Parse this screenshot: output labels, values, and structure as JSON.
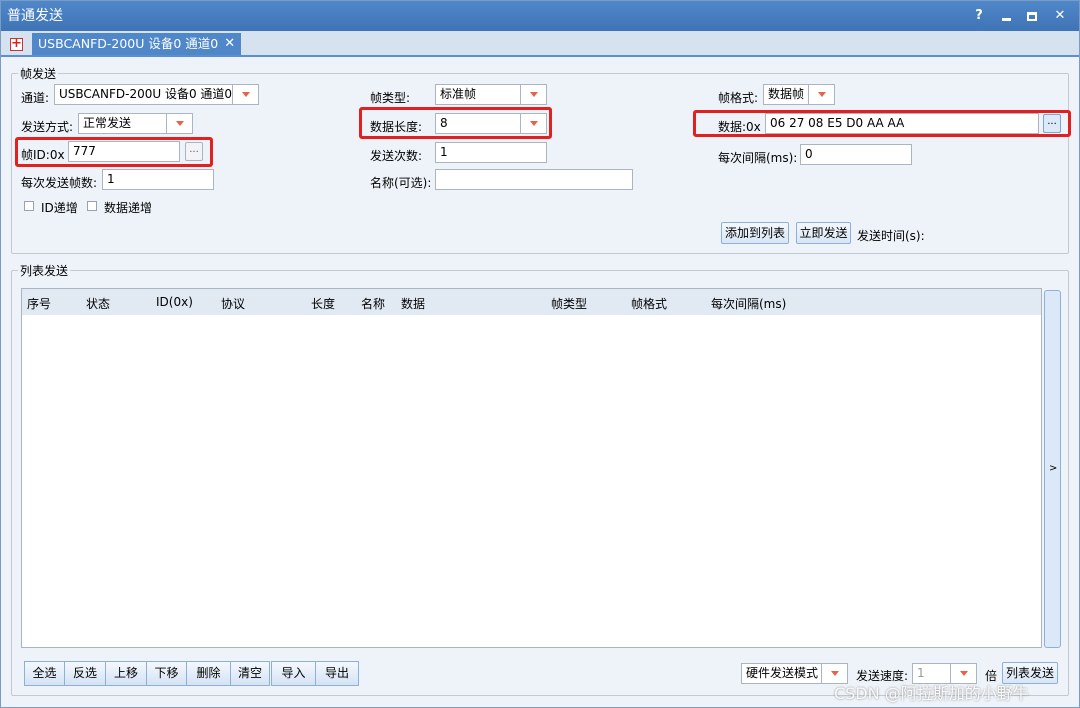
{
  "window": {
    "title": "普通发送"
  },
  "title_controls": {
    "help": "?"
  },
  "tabs": [
    {
      "label": "USBCANFD-200U 设备0 通道0",
      "close": "✕"
    }
  ],
  "tab_add": "+",
  "frame_send": {
    "group_title": "帧发送",
    "channel": {
      "label": "通道:",
      "value": "USBCANFD-200U 设备0 通道0"
    },
    "frame_type": {
      "label": "帧类型:",
      "value": "标准帧"
    },
    "frame_format": {
      "label": "帧格式:",
      "value": "数据帧"
    },
    "send_mode": {
      "label": "发送方式:",
      "value": "正常发送"
    },
    "data_length": {
      "label": "数据长度:",
      "value": "8"
    },
    "data": {
      "label": "数据:0x",
      "value": "06 27 08 E5 D0 AA AA",
      "more": "..."
    },
    "frame_id": {
      "label": "帧ID:0x",
      "value": "777",
      "more": "..."
    },
    "send_count": {
      "label": "发送次数:",
      "value": "1"
    },
    "interval": {
      "label": "每次间隔(ms):",
      "value": "0"
    },
    "frames_per_send": {
      "label": "每次发送帧数:",
      "value": "1"
    },
    "name": {
      "label": "名称(可选):",
      "value": ""
    },
    "id_increment": {
      "label": "ID递增"
    },
    "data_increment": {
      "label": "数据递增"
    },
    "add_to_list": "添加到列表",
    "send_now": "立即发送",
    "send_time": "发送时间(s):"
  },
  "list_send": {
    "group_title": "列表发送",
    "columns": [
      "序号",
      "状态",
      "ID(0x)",
      "协议",
      "长度",
      "名称",
      "数据",
      "帧类型",
      "帧格式",
      "每次间隔(ms)"
    ],
    "side_toggle": ">",
    "buttons_left": [
      "全选",
      "反选",
      "上移",
      "下移",
      "删除",
      "清空"
    ],
    "buttons_io": [
      "导入",
      "导出"
    ],
    "mode": "硬件发送模式",
    "speed_label": "发送速度:",
    "speed_value": "1",
    "speed_unit": "倍",
    "list_send_button": "列表发送"
  },
  "watermark": "CSDN @阿拉斯加的小野牛",
  "colors": {
    "title_bar": "#4f87c8",
    "highlight_box": "#e41f1f",
    "combo_arrow": "#e8624a"
  }
}
